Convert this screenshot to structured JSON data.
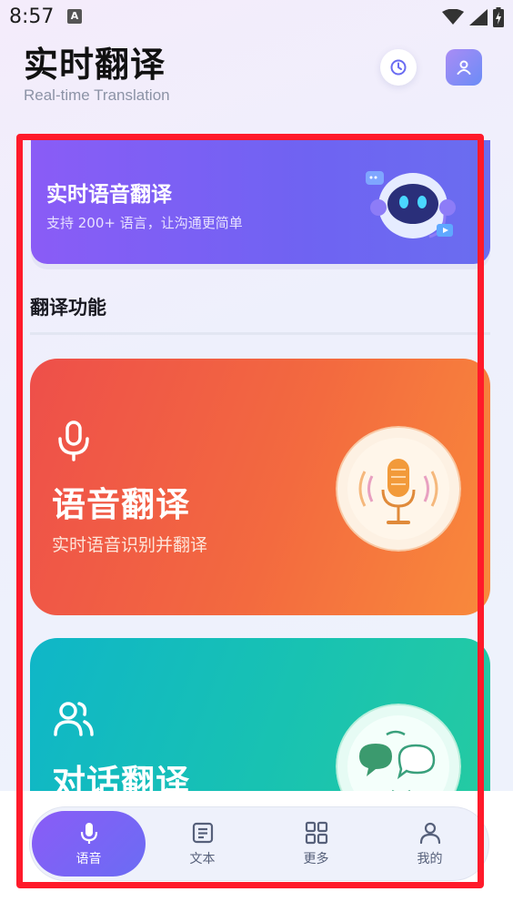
{
  "status_bar": {
    "time": "8:57",
    "notif_glyph": "A",
    "icons": [
      "wifi-icon",
      "signal-icon",
      "battery-charging-icon"
    ]
  },
  "header": {
    "title": "实时翻译",
    "subtitle": "Real-time Translation",
    "icons": [
      "history-icon",
      "user-icon"
    ]
  },
  "banner": {
    "title": "实时语音翻译",
    "subtitle": "支持 200+ 语言，让沟通更简单",
    "art": "robot-headset-illustration"
  },
  "section": {
    "title": "翻译功能"
  },
  "cards": [
    {
      "title": "语音翻译",
      "subtitle": "实时语音识别并翻译",
      "icon": "microphone-icon",
      "color": "#f2623f"
    },
    {
      "title": "对话翻译",
      "icon": "people-icon",
      "color": "#18c2b2"
    }
  ],
  "nav": {
    "items": [
      {
        "label": "语音",
        "icon": "microphone-icon",
        "active": true
      },
      {
        "label": "文本",
        "icon": "text-doc-icon",
        "active": false
      },
      {
        "label": "更多",
        "icon": "grid-icon",
        "active": false
      },
      {
        "label": "我的",
        "icon": "user-icon",
        "active": false
      }
    ]
  },
  "colors": {
    "accent": "#7b5cf5",
    "highlight_frame": "#ff1a2a"
  }
}
